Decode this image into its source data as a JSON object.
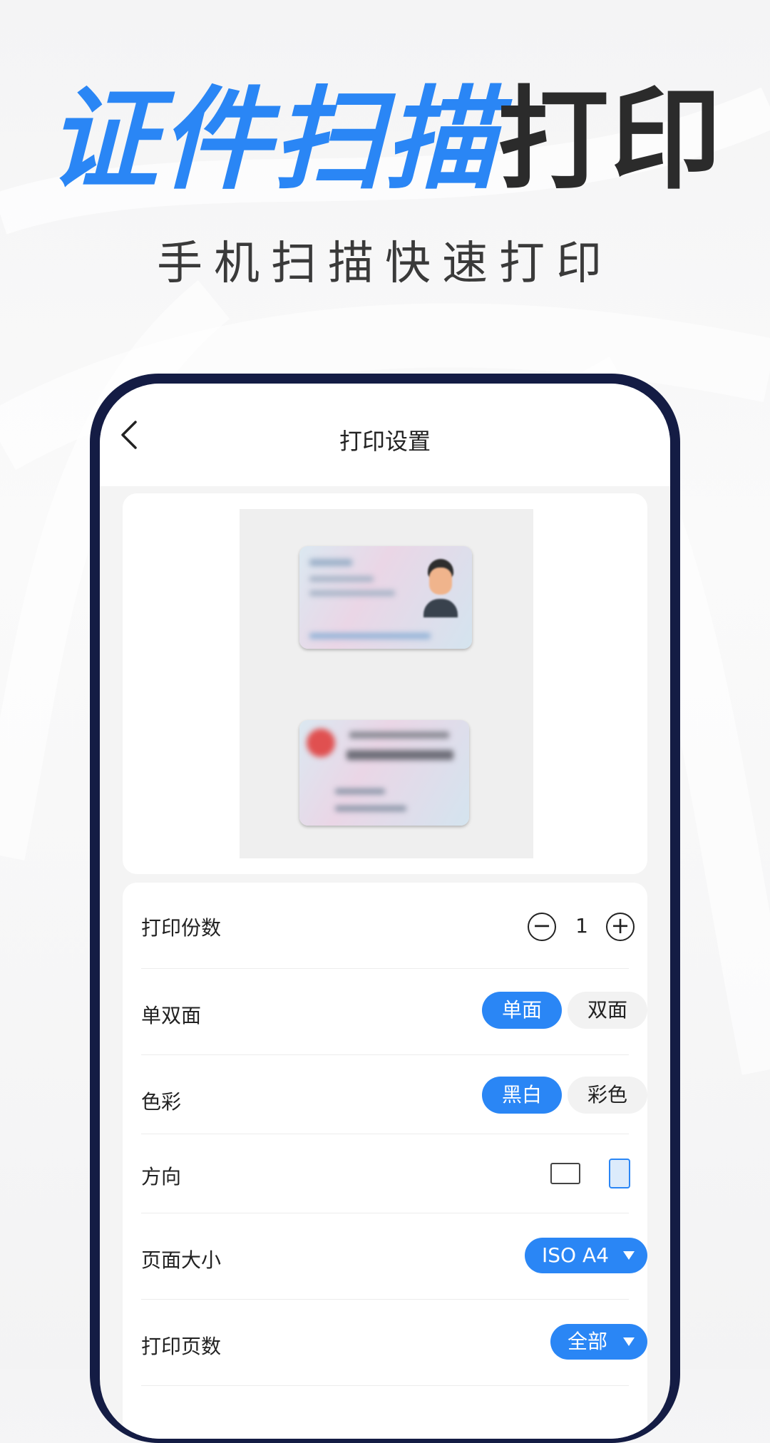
{
  "hero": {
    "title_blue": "证件扫描",
    "title_dark": "打印",
    "subtitle": "手机扫描快速打印"
  },
  "navbar": {
    "title": "打印设置",
    "back_icon": "chevron-left-icon"
  },
  "settings": {
    "copies": {
      "label": "打印份数",
      "value": "1",
      "minus_icon": "minus-circle-icon",
      "plus_icon": "plus-circle-icon"
    },
    "duplex": {
      "label": "单双面",
      "options": [
        "单面",
        "双面"
      ],
      "selected": "单面"
    },
    "color": {
      "label": "色彩",
      "options": [
        "黑白",
        "彩色"
      ],
      "selected": "黑白"
    },
    "orientation": {
      "label": "方向",
      "options": [
        "landscape-icon",
        "portrait-icon"
      ],
      "selected": "portrait-icon"
    },
    "page_size": {
      "label": "页面大小",
      "value": "ISO A4"
    },
    "page_range": {
      "label": "打印页数",
      "value": "全部"
    }
  },
  "colors": {
    "accent": "#2a86f5",
    "phone_frame": "#141c44",
    "title_dark": "#2b2b2b"
  }
}
